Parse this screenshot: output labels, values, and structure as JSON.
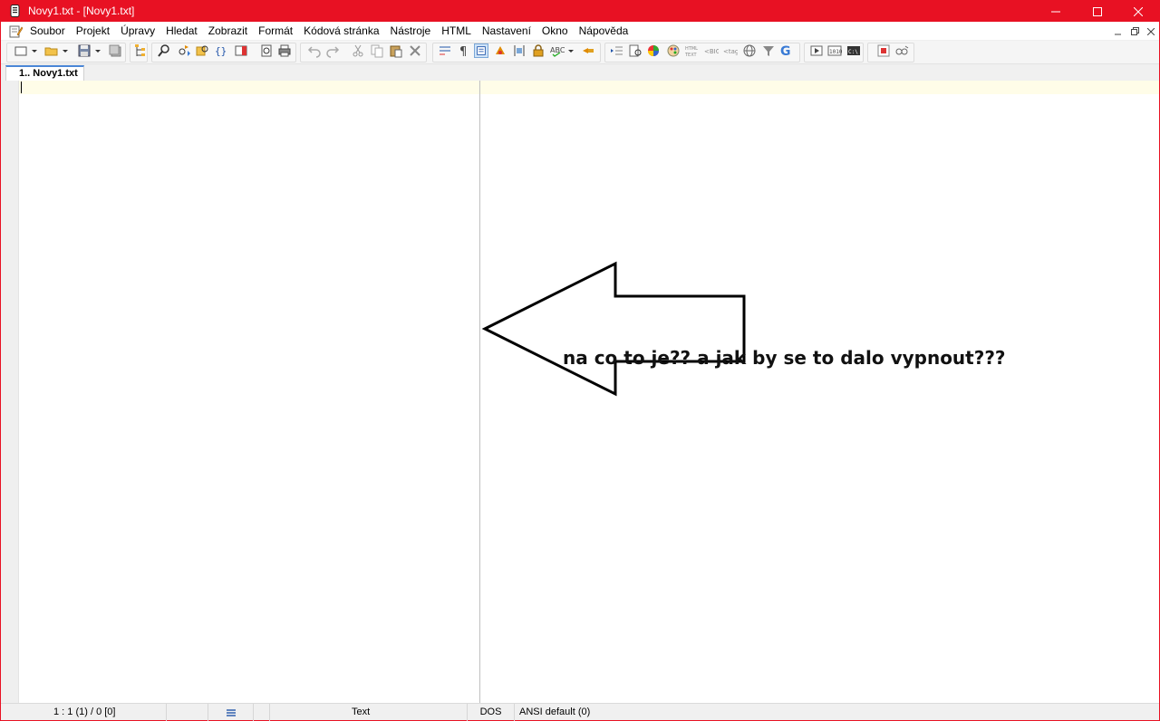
{
  "window": {
    "title": "Novy1.txt - [Novy1.txt]",
    "accent_color": "#e81123"
  },
  "menu": {
    "items": [
      "Soubor",
      "Projekt",
      "Úpravy",
      "Hledat",
      "Zobrazit",
      "Formát",
      "Kódová stránka",
      "Nástroje",
      "HTML",
      "Nastavení",
      "Okno",
      "Nápověda"
    ]
  },
  "toolbar": {
    "icons": [
      "new-file-icon",
      "open-file-icon",
      "save-icon",
      "save-all-icon",
      "close-file-icon",
      "find-icon",
      "replace-icon",
      "find-in-files-icon",
      "print-preview-icon",
      "print-icon",
      "undo-icon",
      "redo-icon",
      "cut-icon",
      "copy-icon",
      "paste-icon",
      "delete-icon",
      "word-wrap-icon",
      "show-spaces-icon",
      "column-mode-icon",
      "read-only-icon",
      "spell-check-icon",
      "html-preview-icon",
      "google-search-icon",
      "run-macro-icon",
      "stop-record-icon"
    ]
  },
  "tabs": [
    {
      "label": "1.. Novy1.txt",
      "active": true
    }
  ],
  "annotation": {
    "text": "na co to je?? a jak by se to dalo vypnout???"
  },
  "status": {
    "position": "1 : 1 (1) / 0  [0]",
    "syntax": "Text",
    "line_ending": "DOS",
    "encoding": "ANSI default (0)"
  }
}
